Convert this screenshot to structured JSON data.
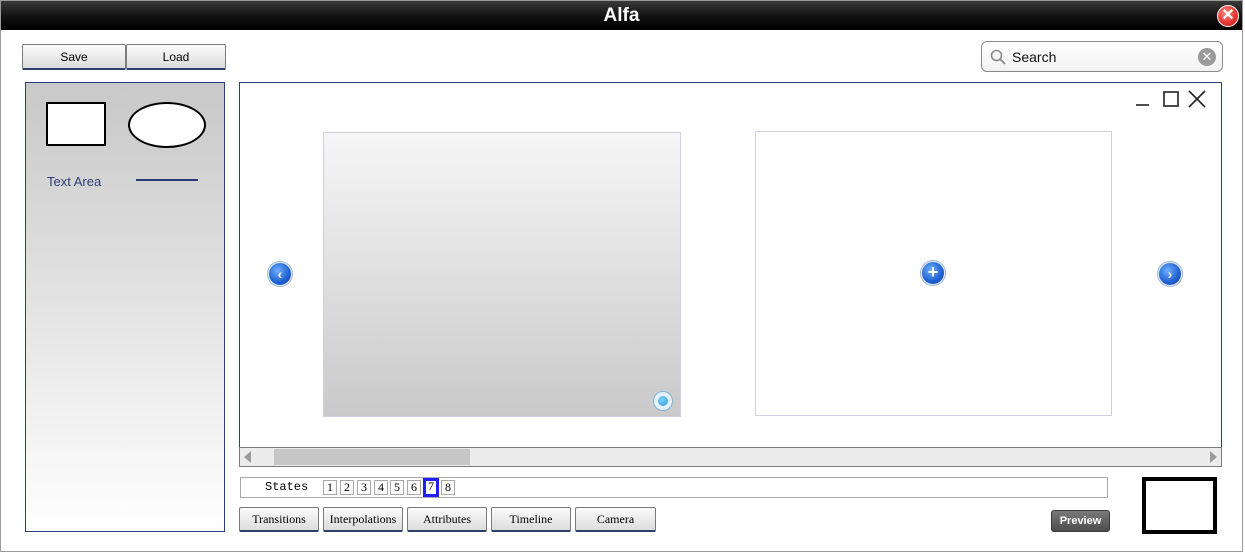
{
  "window": {
    "title": "Alfa"
  },
  "toolbar": {
    "save_label": "Save",
    "load_label": "Load"
  },
  "search": {
    "placeholder": "Search",
    "value": "Search"
  },
  "palette": {
    "text_area_label": "Text Area"
  },
  "states": {
    "label": "States",
    "numbers": [
      "1",
      "2",
      "3",
      "4",
      "5",
      "6",
      "7",
      "8"
    ],
    "active": "7"
  },
  "bottom_tabs": {
    "transitions": "Transitions",
    "interpolations": "Interpolations",
    "attributes": "Attributes",
    "timeline": "Timeline",
    "camera": "Camera"
  },
  "preview": {
    "label": "Preview"
  },
  "icons": {
    "close_window": "close-circle-icon",
    "search": "magnifier-icon",
    "clear": "clear-x-icon",
    "prev": "chevron-left-circle-icon",
    "next": "chevron-right-circle-icon",
    "add": "plus-circle-icon"
  },
  "colors": {
    "accent_blue": "#1f5fd0",
    "active_state_border": "#2020ff",
    "title_bar": "#000000",
    "close_red": "#e53935"
  }
}
